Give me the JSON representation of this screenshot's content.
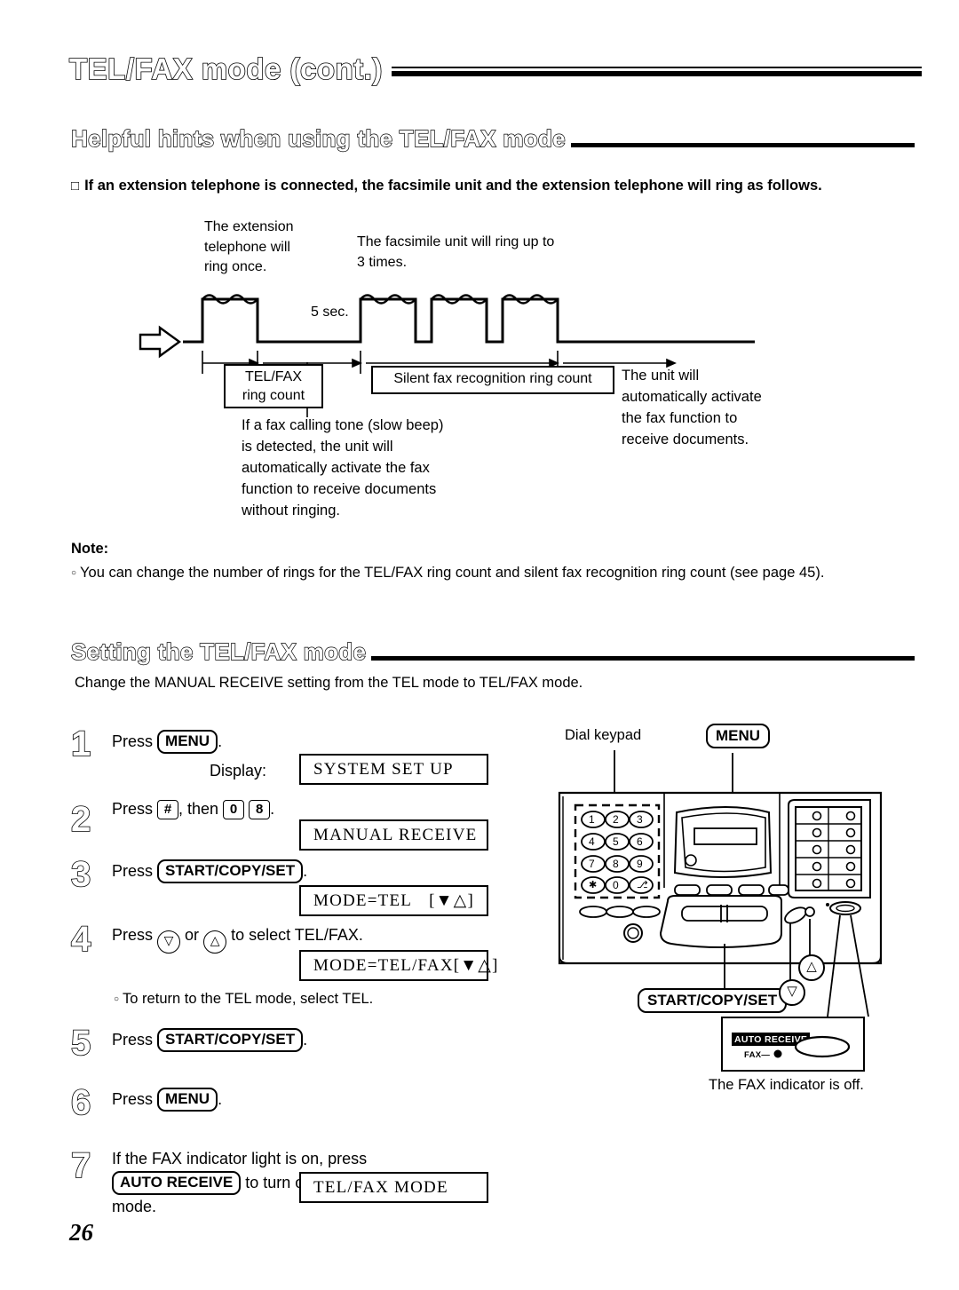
{
  "page": {
    "number": "26",
    "title": "TEL/FAX mode (cont.)"
  },
  "section_hints": {
    "heading": "Helpful hints when using the TEL/FAX mode",
    "bullet": "If an extension telephone is connected, the facsimile unit and the extension telephone will ring as follows."
  },
  "diagram": {
    "label_extension": "The extension\ntelephone will\nring once.",
    "label_facsimile": "The facsimile unit will ring up to\n3 times.",
    "label_gap": "5 sec.",
    "box_telfax_ring_count": "TEL/FAX\nring count",
    "box_silent_ring_count": "Silent fax recognition ring count",
    "note_left": "If a fax calling tone (slow beep)\nis detected, the unit will\nautomatically activate the fax\nfunction to receive documents\nwithout ringing.",
    "note_right": "The unit will\nautomatically activate\nthe fax function to\nreceive documents."
  },
  "note": {
    "heading": "Note:",
    "text": "You can change the number of rings for the TEL/FAX ring count and silent fax recognition ring count (see page 45)."
  },
  "setting": {
    "heading": "Setting the TEL/FAX mode",
    "intro": "Change the MANUAL RECEIVE setting from the TEL mode to TEL/FAX mode."
  },
  "steps": [
    {
      "num": "1",
      "press_word": "Press",
      "button": "MENU",
      "period": ".",
      "display_label": "Display:",
      "lcd": "SYSTEM SET UP"
    },
    {
      "num": "2",
      "press_word": "Press",
      "key1": "#",
      "then_word": ", then",
      "key2": "0",
      "key3": "8",
      "period": ".",
      "lcd": "MANUAL RECEIVE"
    },
    {
      "num": "3",
      "press_word": "Press",
      "button": "START/COPY/SET",
      "period": ".",
      "lcd_left": "MODE=TEL",
      "lcd_right": "[▼△]"
    },
    {
      "num": "4",
      "press_word": "Press",
      "key_down": "▽",
      "or_word": "or",
      "key_up": "△",
      "tail": "to select TEL/FAX.",
      "lcd_left": "MODE=TEL/FAX",
      "lcd_right": "[▼△]",
      "sub_note": "To return to the TEL mode, select TEL."
    },
    {
      "num": "5",
      "press_word": "Press",
      "button": "START/COPY/SET",
      "period": "."
    },
    {
      "num": "6",
      "press_word": "Press",
      "button": "MENU",
      "period": "."
    },
    {
      "num": "7",
      "line1": "If the FAX indicator light is on, press",
      "button": "AUTO RECEIVE",
      "line2": "to turn off the AUTO RECEIVE",
      "line3": "mode.",
      "lcd": "TEL/FAX MODE"
    }
  ],
  "figure": {
    "label_dial_keypad": "Dial keypad",
    "button_menu": "MENU",
    "button_start": "START/COPY/SET",
    "key_down": "▽",
    "key_up": "△",
    "indicator_tag": "AUTO RECEIVE",
    "indicator_fax": "FAX",
    "caption": "The FAX indicator is off.",
    "keypad_keys": [
      "1",
      "2",
      "3",
      "4",
      "5",
      "6",
      "7",
      "8",
      "9",
      "✱",
      "0",
      "⎇"
    ]
  }
}
